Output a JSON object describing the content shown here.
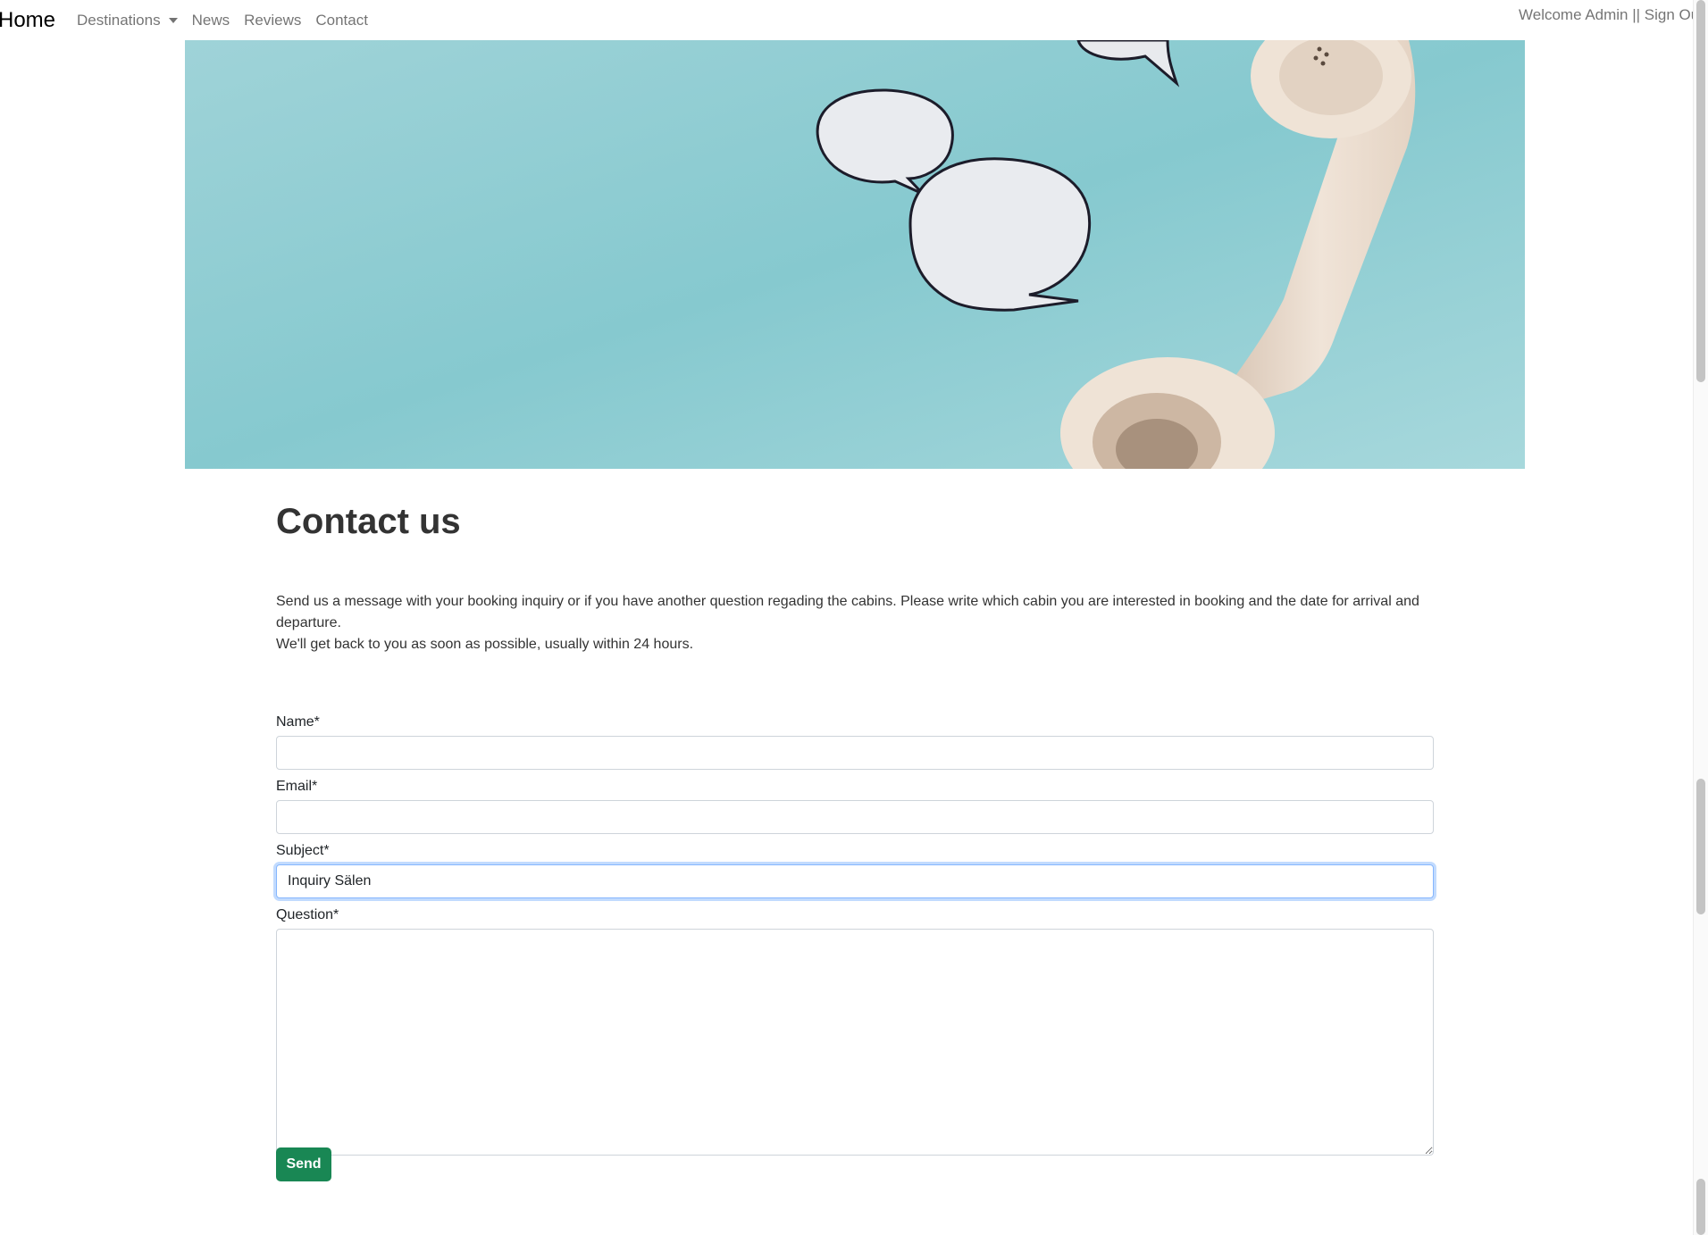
{
  "nav": {
    "brand": "Home",
    "items": [
      {
        "label": "Destinations",
        "has_dropdown": true
      },
      {
        "label": "News"
      },
      {
        "label": "Reviews"
      },
      {
        "label": "Contact"
      }
    ],
    "user_text": "Welcome Admin || Sign Out"
  },
  "hero": {
    "image": "phone-handset-speech-bubbles",
    "bg_color": "#8ccdd3"
  },
  "page": {
    "title": "Contact us",
    "intro_line1": "Send us a message with your booking inquiry or if you have another question regading the cabins. Please write which cabin you are interested in booking and the date for arrival and departure.",
    "intro_line2": "We'll get back to you as soon as possible, usually within 24 hours."
  },
  "form": {
    "name_label": "Name*",
    "name_value": "",
    "email_label": "Email*",
    "email_value": "",
    "subject_label": "Subject*",
    "subject_value": "Inquiry Sälen",
    "question_label": "Question*",
    "question_value": "",
    "submit_label": "Send"
  },
  "colors": {
    "accent": "#198754",
    "focus": "#86b7fe"
  }
}
